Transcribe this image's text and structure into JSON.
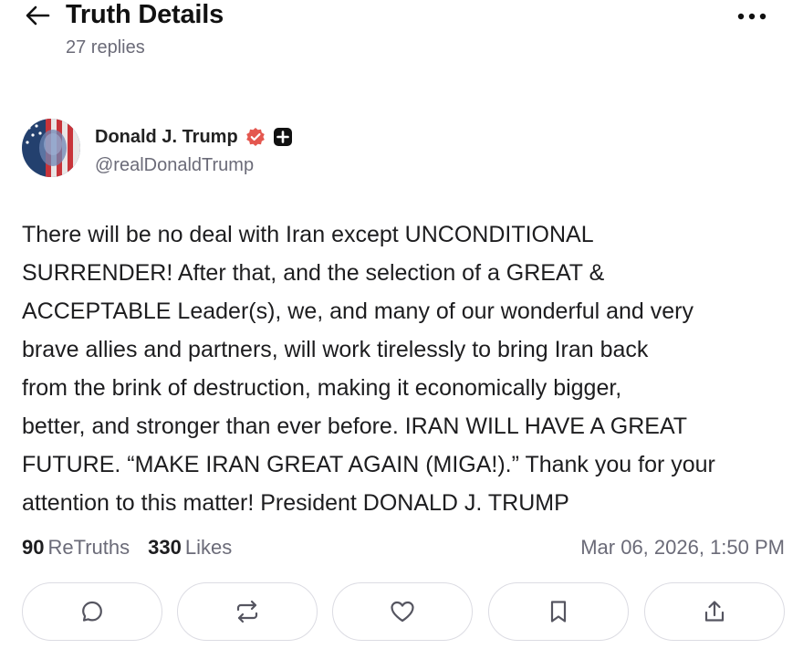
{
  "header": {
    "title": "Truth Details",
    "replies": "27 replies"
  },
  "post": {
    "author": {
      "name": "Donald J. Trump",
      "handle": "@realDonaldTrump"
    },
    "text": "There will be no deal with Iran except UNCONDITIONAL\nSURRENDER! After that, and the selection of a GREAT &\nACCEPTABLE Leader(s), we, and many of our wonderful and very\nbrave allies and partners, will work tirelessly to bring Iran back\nfrom the brink of destruction, making it economically bigger,\nbetter, and stronger than ever before. IRAN WILL HAVE A GREAT\nFUTURE. “MAKE IRAN GREAT AGAIN (MIGA!).” Thank you for your\nattention to this matter! President DONALD J. TRUMP",
    "retruths_count": "90",
    "retruths_label": "ReTruths",
    "likes_count": "330",
    "likes_label": "Likes",
    "timestamp": "Mar 06, 2026, 1:50 PM"
  },
  "colors": {
    "verified_badge": "#e4574f",
    "text_primary": "#1d1d1f",
    "text_secondary": "#6b6b78",
    "button_border": "#dcdce3"
  },
  "icons": {
    "back": "arrow-left-icon",
    "more": "more-horizontal-icon",
    "verified": "verified-badge-icon",
    "plus": "plus-badge-icon",
    "reply": "comment-icon",
    "retruth": "repost-icon",
    "like": "heart-icon",
    "bookmark": "bookmark-icon",
    "share": "share-icon"
  }
}
